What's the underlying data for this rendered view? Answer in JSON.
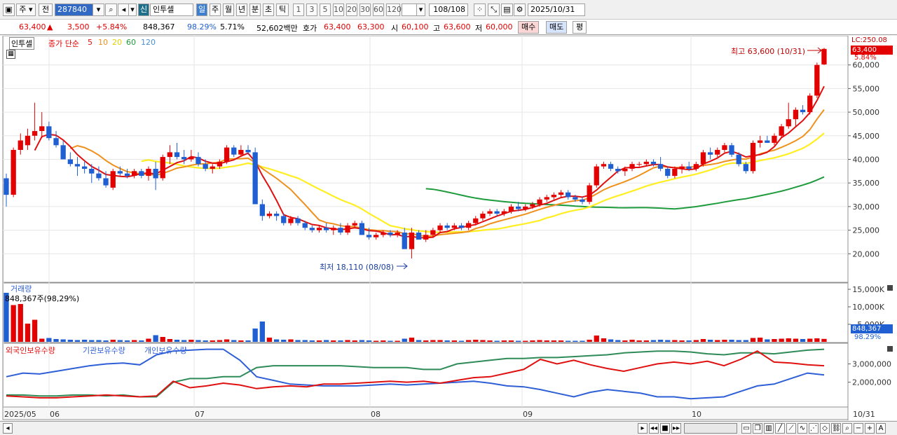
{
  "toolbar": {
    "item1": "주",
    "item2": "전",
    "code": "287840",
    "market_badge": "신",
    "stock_name": "인투셀",
    "period_buttons": [
      "일",
      "주",
      "월",
      "년",
      "분",
      "초",
      "틱"
    ],
    "interval_buttons": [
      "1",
      "3",
      "5",
      "10",
      "20",
      "30",
      "60",
      "120"
    ],
    "page_count": "108/108",
    "date": "2025/10/31"
  },
  "quote": {
    "price": "63,400",
    "arrow": "▲",
    "change": "3,500",
    "change_pct": "+5.84%",
    "volume": "848,367",
    "vol_ratio": "98.29%",
    "turnover": "5.71%",
    "amount": "52,602백만",
    "bid_label": "호가",
    "bid1": "63,400",
    "bid2": "63,300",
    "open_label": "시",
    "open": "60,100",
    "high_label": "고",
    "high": "63,600",
    "low_label": "저",
    "low": "60,000",
    "buy_button": "매수",
    "sell_button": "매도",
    "eval_button": "평"
  },
  "legend": {
    "stock": "인투셀",
    "ma_title": "종가 단순",
    "ma_periods": [
      "5",
      "10",
      "20",
      "60",
      "120"
    ],
    "volume_title": "거래량",
    "volume_info": "848,367주(98,29%)",
    "holding_titles": [
      "외국인보유수량",
      "기관보유수량",
      "개인보유수량"
    ]
  },
  "annotations": {
    "high": "최고 63,600 (10/31)",
    "low": "최저 18,110 (08/08)"
  },
  "right_axis": {
    "top": "LC:250.08",
    "price_tag": "63,400",
    "pct_tag": "5.84%",
    "vol_tag": "848,367",
    "vol_pct_tag": "98.29%"
  },
  "colors": {
    "up": "#e30000",
    "down": "#1f5fd1",
    "ma5": "#e01010",
    "ma10": "#f0901c",
    "ma20": "#ffee22",
    "ma60": "#1e9b3c",
    "ma120": "#4b8fd6",
    "foreign": "#e01010",
    "institution": "#2e8b57",
    "individual": "#2f5fd6"
  },
  "chart_data": [
    {
      "type": "candlestick",
      "title": "인투셀",
      "ylim": [
        15000,
        65000
      ],
      "yticks": [
        "60,000",
        "55,000",
        "50,000",
        "45,000",
        "40,000",
        "35,000",
        "30,000",
        "25,000",
        "20,000"
      ],
      "xticks": [
        "2025/05",
        "06",
        "07",
        "08",
        "09",
        "10",
        "10/31"
      ],
      "candles": [
        [
          36000,
          37000,
          30000,
          32500
        ],
        [
          32500,
          42500,
          32000,
          42000
        ],
        [
          42000,
          45500,
          41000,
          44000
        ],
        [
          43000,
          46500,
          42000,
          45000
        ],
        [
          45000,
          52000,
          44000,
          46000
        ],
        [
          46000,
          50000,
          44500,
          47000
        ],
        [
          47000,
          48000,
          44000,
          44500
        ],
        [
          44500,
          46000,
          42500,
          43000
        ],
        [
          43000,
          44000,
          40000,
          40000
        ],
        [
          40000,
          41500,
          38500,
          39000
        ],
        [
          39000,
          40500,
          36500,
          38500
        ],
        [
          38500,
          39500,
          37000,
          38000
        ],
        [
          38000,
          39000,
          35000,
          37000
        ],
        [
          37000,
          38500,
          35500,
          36000
        ],
        [
          36000,
          37500,
          34000,
          34500
        ],
        [
          34000,
          38000,
          33500,
          37500
        ],
        [
          37500,
          38500,
          36500,
          37000
        ],
        [
          37000,
          38000,
          36000,
          36500
        ],
        [
          36500,
          38000,
          36000,
          37500
        ],
        [
          37500,
          38000,
          36000,
          36500
        ],
        [
          36500,
          38500,
          35500,
          38000
        ],
        [
          38000,
          39500,
          33500,
          36000
        ],
        [
          36000,
          41000,
          35500,
          40500
        ],
        [
          40500,
          43000,
          39000,
          41500
        ],
        [
          41500,
          43500,
          40000,
          40500
        ],
        [
          40500,
          42000,
          39000,
          40000
        ],
        [
          40000,
          42000,
          39500,
          40500
        ],
        [
          40500,
          41500,
          38500,
          39000
        ],
        [
          39000,
          40000,
          37500,
          38000
        ],
        [
          38000,
          39000,
          37000,
          38500
        ],
        [
          38500,
          40000,
          38000,
          39500
        ],
        [
          39500,
          43000,
          39000,
          42500
        ],
        [
          42500,
          43000,
          40500,
          41000
        ],
        [
          41000,
          43000,
          40500,
          42000
        ],
        [
          42000,
          43000,
          41000,
          41500
        ],
        [
          41500,
          42500,
          38000,
          30500
        ],
        [
          30500,
          31500,
          27000,
          28000
        ],
        [
          28000,
          29000,
          27500,
          28500
        ],
        [
          28500,
          29000,
          27000,
          28000
        ],
        [
          28000,
          28500,
          26000,
          26500
        ],
        [
          26500,
          28000,
          26000,
          27500
        ],
        [
          27500,
          28000,
          26000,
          26500
        ],
        [
          26500,
          27000,
          25000,
          25500
        ],
        [
          25500,
          26000,
          24500,
          25000
        ],
        [
          25000,
          26000,
          24500,
          25500
        ],
        [
          25500,
          26500,
          24500,
          25000
        ],
        [
          25000,
          26000,
          24000,
          25500
        ],
        [
          25500,
          26500,
          24000,
          24500
        ],
        [
          24500,
          26500,
          24000,
          26000
        ],
        [
          26000,
          27000,
          25500,
          26500
        ],
        [
          26500,
          27000,
          24000,
          24000
        ],
        [
          24000,
          25500,
          23000,
          23500
        ],
        [
          23500,
          24500,
          23000,
          24000
        ],
        [
          24000,
          25000,
          23500,
          24500
        ],
        [
          24500,
          25000,
          23500,
          24000
        ],
        [
          24000,
          25000,
          23500,
          24500
        ],
        [
          24500,
          25500,
          22000,
          21000
        ],
        [
          21000,
          25500,
          19000,
          24500
        ],
        [
          24500,
          25000,
          23000,
          23000
        ],
        [
          23000,
          25000,
          22500,
          24000
        ],
        [
          24000,
          25500,
          23500,
          25000
        ],
        [
          25000,
          26500,
          24500,
          26000
        ],
        [
          26000,
          26500,
          25000,
          25500
        ],
        [
          25500,
          26500,
          25000,
          26000
        ],
        [
          26000,
          26500,
          25000,
          25500
        ],
        [
          25500,
          27000,
          25000,
          26500
        ],
        [
          26500,
          28000,
          26000,
          27500
        ],
        [
          27500,
          29000,
          27000,
          28500
        ],
        [
          28500,
          29500,
          28000,
          29000
        ],
        [
          29000,
          29500,
          28000,
          28500
        ],
        [
          28500,
          29500,
          28000,
          29000
        ],
        [
          29000,
          30500,
          28500,
          30000
        ],
        [
          30000,
          31000,
          29000,
          29500
        ],
        [
          29500,
          30500,
          29000,
          30000
        ],
        [
          30000,
          31000,
          29500,
          30500
        ],
        [
          30500,
          32000,
          30000,
          31500
        ],
        [
          31500,
          32500,
          31000,
          32000
        ],
        [
          32000,
          33000,
          31500,
          32500
        ],
        [
          32500,
          33500,
          32000,
          33000
        ],
        [
          33000,
          33500,
          31500,
          32000
        ],
        [
          32000,
          32500,
          31000,
          31500
        ],
        [
          31500,
          32000,
          30500,
          31000
        ],
        [
          31000,
          35000,
          30500,
          34500
        ],
        [
          34500,
          39000,
          34000,
          38500
        ],
        [
          38500,
          39500,
          38000,
          39000
        ],
        [
          39000,
          39500,
          37500,
          38000
        ],
        [
          38000,
          38500,
          37000,
          37500
        ],
        [
          37500,
          38500,
          36500,
          38000
        ],
        [
          38000,
          39500,
          37500,
          39000
        ],
        [
          39000,
          39500,
          38500,
          39000
        ],
        [
          39000,
          40000,
          38500,
          39500
        ],
        [
          39500,
          40000,
          38500,
          39000
        ],
        [
          39000,
          40500,
          37500,
          38000
        ],
        [
          38000,
          38500,
          36000,
          36500
        ],
        [
          36500,
          38500,
          36000,
          38000
        ],
        [
          38000,
          39000,
          37000,
          38500
        ],
        [
          38500,
          39500,
          37500,
          38000
        ],
        [
          38000,
          39500,
          37500,
          39000
        ],
        [
          39000,
          42000,
          38500,
          41500
        ],
        [
          41500,
          42500,
          40000,
          41000
        ],
        [
          41000,
          42500,
          40500,
          42000
        ],
        [
          42000,
          43500,
          41500,
          43000
        ],
        [
          43000,
          43500,
          40500,
          41000
        ],
        [
          41000,
          41500,
          38500,
          39000
        ],
        [
          39000,
          39500,
          37000,
          37500
        ],
        [
          37500,
          44000,
          37000,
          43500
        ],
        [
          43500,
          45000,
          42500,
          44000
        ],
        [
          44000,
          45000,
          43500,
          43500
        ],
        [
          43500,
          45500,
          43000,
          45000
        ],
        [
          45000,
          47500,
          44500,
          47000
        ],
        [
          47000,
          52000,
          46500,
          48500
        ],
        [
          48500,
          51000,
          47000,
          50500
        ],
        [
          50500,
          51500,
          49500,
          50000
        ],
        [
          50000,
          54000,
          49500,
          53500
        ],
        [
          53500,
          60500,
          53000,
          60000
        ],
        [
          60100,
          63600,
          60000,
          63400
        ]
      ]
    },
    {
      "type": "bar",
      "title": "거래량",
      "ylim": [
        0,
        16000000
      ],
      "yticks": [
        "15,000K",
        "10,000K",
        "5,000K"
      ],
      "values": [
        14000000,
        10500000,
        10800000,
        5200000,
        6300000,
        900000,
        1100000,
        800000,
        700000,
        600000,
        500000,
        600000,
        500000,
        500000,
        400000,
        600000,
        500000,
        400000,
        500000,
        400000,
        900000,
        1900000,
        1400000,
        800000,
        600000,
        500000,
        600000,
        500000,
        400000,
        400000,
        500000,
        700000,
        500000,
        400000,
        400000,
        3800000,
        5800000,
        1200000,
        700000,
        600000,
        700000,
        500000,
        500000,
        400000,
        400000,
        500000,
        400000,
        400000,
        500000,
        400000,
        500000,
        400000,
        300000,
        400000,
        300000,
        300000,
        900000,
        1200000,
        500000,
        400000,
        500000,
        500000,
        400000,
        400000,
        300000,
        500000,
        600000,
        500000,
        400000,
        300000,
        400000,
        400000,
        300000,
        300000,
        400000,
        500000,
        400000,
        400000,
        400000,
        300000,
        300000,
        300000,
        600000,
        1800000,
        1000000,
        700000,
        500000,
        400000,
        600000,
        400000,
        400000,
        500000,
        600000,
        500000,
        500000,
        400000,
        400000,
        500000,
        800000,
        600000,
        500000,
        600000,
        600000,
        500000,
        500000,
        1100000,
        1200000,
        700000,
        800000,
        900000,
        1000000,
        900000,
        800000,
        900000,
        1000000,
        848367
      ]
    },
    {
      "type": "line",
      "title": "외국인보유수량 기관보유수량 개인보유수량",
      "yticks": [
        "3,000,000",
        "2,000,000"
      ],
      "ylim": [
        800000,
        3900000
      ]
    }
  ]
}
